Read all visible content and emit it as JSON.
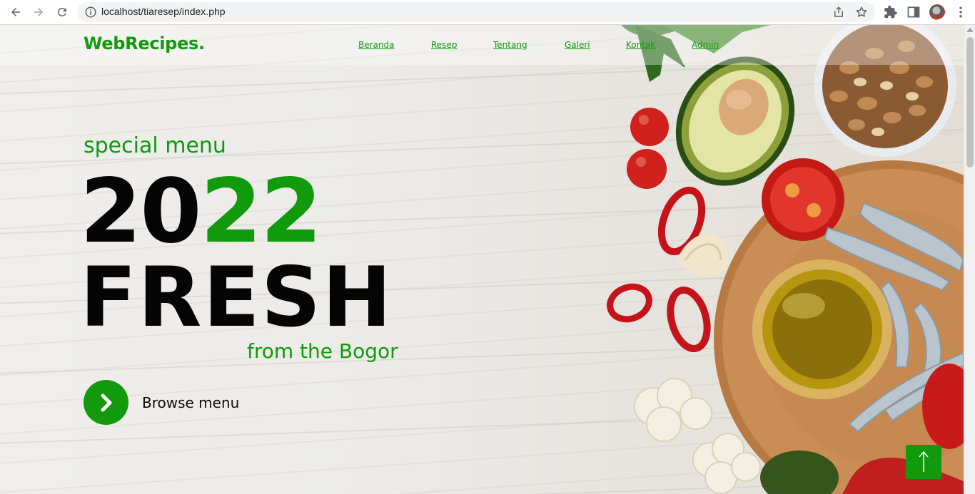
{
  "browser": {
    "url": "localhost/tiaresep/index.php"
  },
  "site": {
    "brand": "WebRecipes.",
    "nav": [
      {
        "label": "Beranda"
      },
      {
        "label": "Resep"
      },
      {
        "label": "Tentang"
      },
      {
        "label": "Galeri"
      },
      {
        "label": "Kontak"
      },
      {
        "label": "Admin"
      }
    ]
  },
  "hero": {
    "subtitle": "special menu",
    "year_part1": "20",
    "year_part2": "22",
    "headline": "FRESH",
    "origin": "from the Bogor",
    "cta_label": "Browse menu"
  },
  "colors": {
    "accent": "#109a0c",
    "text_dark": "#050505"
  },
  "icons": {
    "cta": "chevron-right-icon",
    "back_to_top": "arrow-up-icon"
  }
}
